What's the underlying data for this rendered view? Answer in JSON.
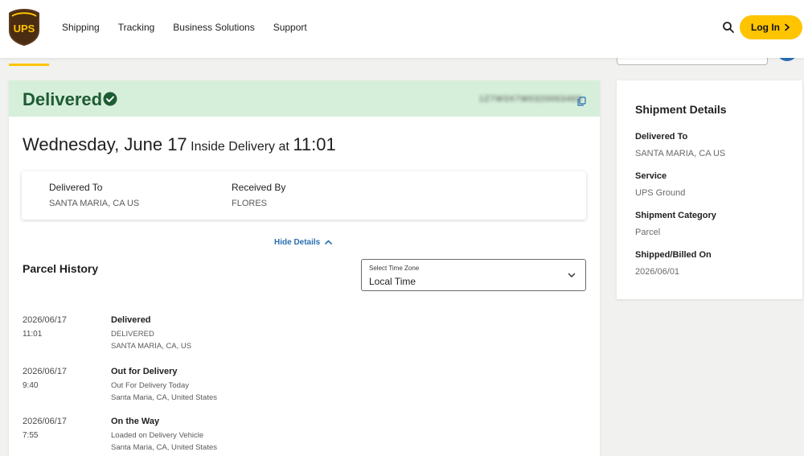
{
  "header": {
    "brand": "UPS",
    "nav": [
      "Shipping",
      "Tracking",
      "Business Solutions",
      "Support"
    ],
    "login_label": "Log In",
    "icons": {
      "search": "search-icon",
      "login": "chevron-right-icon"
    }
  },
  "status": {
    "title": "Delivered",
    "tracking_number": "1Z7W3X7W0320063469",
    "accent_color": "#1e5b32",
    "banner_color": "#d6efdb"
  },
  "delivery": {
    "day": "Wednesday, June 17",
    "method": "Inside Delivery",
    "at": "at",
    "time": "11:01"
  },
  "summary": {
    "delivered_to_label": "Delivered To",
    "delivered_to_value": "SANTA MARIA, CA US",
    "received_by_label": "Received By",
    "received_by_value": "FLORES"
  },
  "hide_details_label": "Hide Details",
  "parcel_history": {
    "title": "Parcel History",
    "timezone_label": "Select Time Zone",
    "timezone_value": "Local Time",
    "events": [
      {
        "date": "2026/06/17",
        "time": "11:01",
        "title": "Delivered",
        "desc": "DELIVERED",
        "location": "SANTA MARIA, CA, US"
      },
      {
        "date": "2026/06/17",
        "time": "9:40",
        "title": "Out for Delivery",
        "desc": "Out For Delivery Today",
        "location": "Santa Maria, CA, United States"
      },
      {
        "date": "2026/06/17",
        "time": "7:55",
        "title": "On the Way",
        "desc": "Loaded on Delivery Vehicle",
        "location": "Santa Maria, CA, United States"
      }
    ]
  },
  "shipment_details": {
    "title": "Shipment Details",
    "fields": [
      {
        "label": "Delivered To",
        "value": "SANTA MARIA, CA US"
      },
      {
        "label": "Service",
        "value": "UPS Ground"
      },
      {
        "label": "Shipment Category",
        "value": "Parcel"
      },
      {
        "label": "Shipped/Billed On",
        "value": "2026/06/01"
      }
    ]
  }
}
